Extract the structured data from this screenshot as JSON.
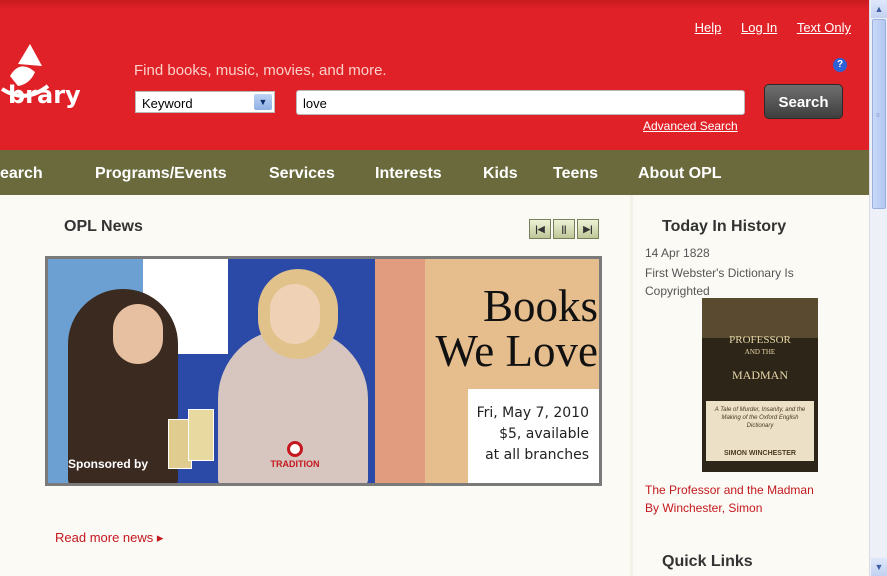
{
  "header": {
    "logo_text": "brary",
    "top_links": [
      "Help",
      "Log In",
      "Text Only"
    ],
    "tagline": "Find books, music, movies, and more.",
    "help_icon": "?",
    "search": {
      "type_value": "Keyword",
      "query_value": "love",
      "button_label": "Search",
      "advanced_label": "Advanced Search"
    }
  },
  "nav": {
    "items": [
      "earch",
      "Programs/Events",
      "Services",
      "Interests",
      "Kids",
      "Teens",
      "About OPL"
    ]
  },
  "news": {
    "title": "OPL News",
    "carousel_prev": "|◀",
    "carousel_pause": "||",
    "carousel_next": "▶|",
    "banner": {
      "headline_line1": "Books",
      "headline_line2": "We Love",
      "date": "Fri, May 7, 2010",
      "price": "$5, available",
      "location": "at all branches",
      "sponsored": "Sponsored by"
    },
    "read_more": "Read more news ▸"
  },
  "sidebar": {
    "history_title": "Today In History",
    "history_date": "14 Apr 1828",
    "history_event": "First Webster's Dictionary Is Copyrighted",
    "book_cover": {
      "title_top": "PROFESSOR",
      "title_mid": "AND THE",
      "title_bottom": "MADMAN",
      "subtitle": "A Tale of Murder, Insanity, and the Making of the Oxford English Dictionary",
      "author": "SIMON WINCHESTER"
    },
    "book_title": "The Professor and the Madman",
    "book_author": "By Winchester, Simon",
    "quick_links_title": "Quick Links"
  },
  "colors": {
    "brand_red": "#e02228",
    "nav_olive": "#6a6a3d",
    "link_red": "#c4181e"
  }
}
